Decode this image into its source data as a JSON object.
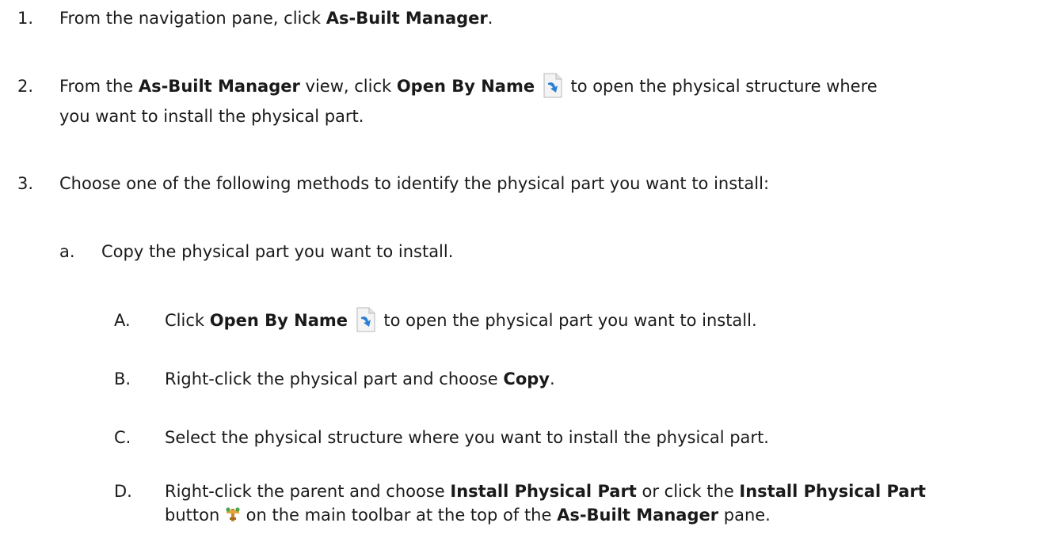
{
  "steps": {
    "s1": {
      "num": "1.",
      "p1": "From the navigation pane, click ",
      "b1": "As-Built Manager",
      "p2": "."
    },
    "s2": {
      "num": "2.",
      "p1": "From the ",
      "b1": "As-Built Manager",
      "p2": " view, click ",
      "b2": "Open By Name",
      "p3": " to open the physical structure where",
      "line2": "you want to install the physical part."
    },
    "s3": {
      "num": "3.",
      "p1": "Choose one of the following methods to identify the physical part you want to install:"
    },
    "sa": {
      "num": "a.",
      "p1": "Copy the physical part you want to install."
    },
    "sA": {
      "num": "A.",
      "p1": "Click ",
      "b1": "Open By Name",
      "p2": " to open the physical part you want to install."
    },
    "sB": {
      "num": "B.",
      "p1": "Right-click the physical part and choose ",
      "b1": "Copy",
      "p2": "."
    },
    "sC": {
      "num": "C.",
      "p1": "Select the physical structure where you want to install the physical part."
    },
    "sD": {
      "num": "D.",
      "p1": "Right-click the parent and choose ",
      "b1": "Install Physical Part",
      "p2": " or click the ",
      "b2": "Install Physical Part",
      "line2_p1": "button ",
      "line2_p2": " on the main toolbar at the top of the ",
      "line2_b1": "As-Built Manager",
      "line2_p3": " pane."
    }
  },
  "icons": {
    "open_by_name": "open-by-name-icon",
    "install_physical_part": "install-physical-part-icon"
  }
}
